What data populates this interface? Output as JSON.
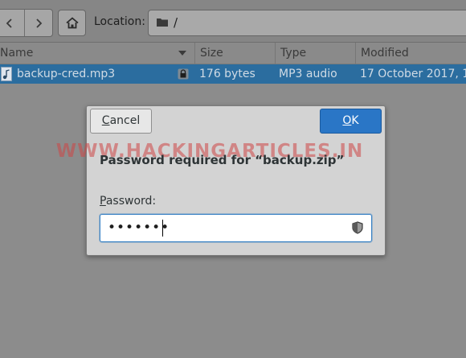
{
  "toolbar": {
    "back_icon": "chevron-left-icon",
    "forward_icon": "chevron-right-icon",
    "home_icon": "home-icon",
    "location_label": "Location:",
    "location_path": "/"
  },
  "file_list": {
    "columns": [
      "Name",
      "Size",
      "Type",
      "Modified"
    ],
    "rows": [
      {
        "name": "backup-cred.mp3",
        "size": "176 bytes",
        "type": "MP3 audio",
        "modified": "17 October 2017, 1…"
      }
    ],
    "selection_color": "#2b6d9f"
  },
  "dialog": {
    "cancel_label": "Cancel",
    "ok_label": "OK",
    "watermark": "WWW.HACKINGARTICLES.IN",
    "title": "Password required for “backup.zip”",
    "password_label": "Password:",
    "password_value": "•••••••",
    "accent_color": "#2a76c6"
  }
}
